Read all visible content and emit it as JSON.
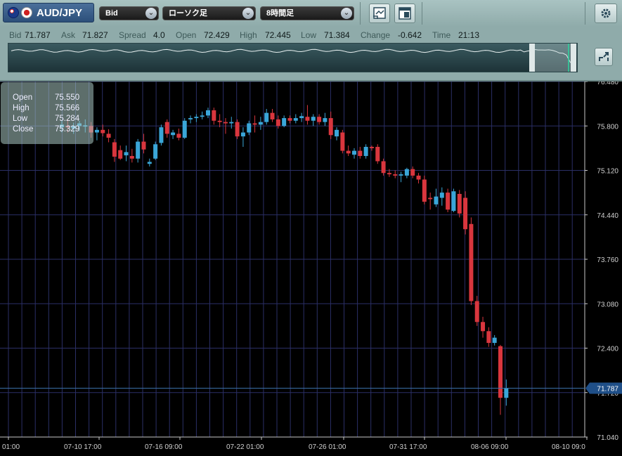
{
  "toolbar": {
    "symbol": "AUD/JPY",
    "price_type": "Bid",
    "chart_type": "ローソク足",
    "timeframe": "8時間足"
  },
  "quote": {
    "bid_label": "Bid",
    "bid": "71.787",
    "ask_label": "Ask",
    "ask": "71.827",
    "spread_label": "Spread",
    "spread": "4.0",
    "open_label": "Open",
    "open": "72.429",
    "high_label": "High",
    "high": "72.445",
    "low_label": "Low",
    "low": "71.384",
    "change_label": "Change",
    "change": "-0.642",
    "time_label": "Time",
    "time": "21:13"
  },
  "ohlc_popup": {
    "open_label": "Open",
    "open": "75.550",
    "high_label": "High",
    "high": "75.566",
    "low_label": "Low",
    "low": "75.284",
    "close_label": "Close",
    "close": "75.329"
  },
  "colors": {
    "up": "#3aa6d8",
    "down": "#d9363e",
    "grid": "#2b2f66",
    "axis_text": "#d0d0d0"
  },
  "chart_data": {
    "type": "candlestick",
    "ylim": [
      71.04,
      76.48
    ],
    "y_ticks": [
      "76.480",
      "75.800",
      "75.120",
      "74.440",
      "73.760",
      "73.080",
      "72.400",
      "71.720",
      "71.040"
    ],
    "x_ticks": [
      "01:00",
      "07-10 17:00",
      "07-16 09:00",
      "07-22 01:00",
      "07-26 01:00",
      "07-31 17:00",
      "08-06 09:00",
      "08-10 09:0"
    ],
    "current_price": "71.787",
    "candles": [
      {
        "o": 75.78,
        "h": 75.88,
        "l": 75.7,
        "c": 75.82
      },
      {
        "o": 75.8,
        "h": 75.9,
        "l": 75.7,
        "c": 75.78
      },
      {
        "o": 75.76,
        "h": 75.85,
        "l": 75.68,
        "c": 75.8
      },
      {
        "o": 75.8,
        "h": 75.88,
        "l": 75.72,
        "c": 75.84
      },
      {
        "o": 75.79,
        "h": 75.9,
        "l": 75.7,
        "c": 75.81
      },
      {
        "o": 75.8,
        "h": 75.86,
        "l": 75.62,
        "c": 75.7
      },
      {
        "o": 75.7,
        "h": 75.78,
        "l": 75.58,
        "c": 75.74
      },
      {
        "o": 75.74,
        "h": 75.82,
        "l": 75.64,
        "c": 75.69
      },
      {
        "o": 75.68,
        "h": 75.75,
        "l": 75.55,
        "c": 75.62
      },
      {
        "o": 75.55,
        "h": 75.6,
        "l": 75.25,
        "c": 75.33
      },
      {
        "o": 75.43,
        "h": 75.5,
        "l": 75.28,
        "c": 75.3
      },
      {
        "o": 75.35,
        "h": 75.5,
        "l": 75.26,
        "c": 75.4
      },
      {
        "o": 75.34,
        "h": 75.45,
        "l": 75.24,
        "c": 75.3
      },
      {
        "o": 75.3,
        "h": 75.6,
        "l": 75.24,
        "c": 75.56
      },
      {
        "o": 75.56,
        "h": 75.68,
        "l": 75.38,
        "c": 75.44
      },
      {
        "o": 75.22,
        "h": 75.3,
        "l": 75.18,
        "c": 75.25
      },
      {
        "o": 75.3,
        "h": 75.56,
        "l": 75.28,
        "c": 75.52
      },
      {
        "o": 75.54,
        "h": 75.82,
        "l": 75.5,
        "c": 75.78
      },
      {
        "o": 75.86,
        "h": 75.9,
        "l": 75.62,
        "c": 75.68
      },
      {
        "o": 75.66,
        "h": 75.74,
        "l": 75.6,
        "c": 75.7
      },
      {
        "o": 75.68,
        "h": 75.76,
        "l": 75.58,
        "c": 75.62
      },
      {
        "o": 75.62,
        "h": 75.92,
        "l": 75.6,
        "c": 75.88
      },
      {
        "o": 75.9,
        "h": 75.96,
        "l": 75.84,
        "c": 75.92
      },
      {
        "o": 75.92,
        "h": 75.98,
        "l": 75.86,
        "c": 75.94
      },
      {
        "o": 75.94,
        "h": 76.02,
        "l": 75.9,
        "c": 75.96
      },
      {
        "o": 75.96,
        "h": 76.08,
        "l": 75.92,
        "c": 76.04
      },
      {
        "o": 76.04,
        "h": 76.08,
        "l": 75.82,
        "c": 75.88
      },
      {
        "o": 75.88,
        "h": 75.98,
        "l": 75.78,
        "c": 75.86
      },
      {
        "o": 75.86,
        "h": 75.92,
        "l": 75.68,
        "c": 75.84
      },
      {
        "o": 75.84,
        "h": 75.94,
        "l": 75.76,
        "c": 75.86
      },
      {
        "o": 75.86,
        "h": 75.9,
        "l": 75.6,
        "c": 75.64
      },
      {
        "o": 75.64,
        "h": 75.78,
        "l": 75.48,
        "c": 75.7
      },
      {
        "o": 75.7,
        "h": 75.88,
        "l": 75.66,
        "c": 75.84
      },
      {
        "o": 75.84,
        "h": 75.96,
        "l": 75.7,
        "c": 75.82
      },
      {
        "o": 75.82,
        "h": 75.94,
        "l": 75.74,
        "c": 75.86
      },
      {
        "o": 75.86,
        "h": 76.06,
        "l": 75.82,
        "c": 76.0
      },
      {
        "o": 76.0,
        "h": 76.06,
        "l": 75.86,
        "c": 75.9
      },
      {
        "o": 75.9,
        "h": 75.96,
        "l": 75.76,
        "c": 75.8
      },
      {
        "o": 75.8,
        "h": 75.96,
        "l": 75.78,
        "c": 75.92
      },
      {
        "o": 75.92,
        "h": 75.96,
        "l": 75.84,
        "c": 75.88
      },
      {
        "o": 75.88,
        "h": 75.98,
        "l": 75.84,
        "c": 75.92
      },
      {
        "o": 75.92,
        "h": 76.0,
        "l": 75.86,
        "c": 75.95
      },
      {
        "o": 75.94,
        "h": 76.12,
        "l": 75.82,
        "c": 75.88
      },
      {
        "o": 75.88,
        "h": 75.98,
        "l": 75.8,
        "c": 75.94
      },
      {
        "o": 75.94,
        "h": 75.98,
        "l": 75.82,
        "c": 75.86
      },
      {
        "o": 75.86,
        "h": 76.0,
        "l": 75.8,
        "c": 75.92
      },
      {
        "o": 75.92,
        "h": 76.02,
        "l": 75.6,
        "c": 75.66
      },
      {
        "o": 75.64,
        "h": 75.78,
        "l": 75.58,
        "c": 75.74
      },
      {
        "o": 75.7,
        "h": 75.74,
        "l": 75.38,
        "c": 75.42
      },
      {
        "o": 75.42,
        "h": 75.5,
        "l": 75.34,
        "c": 75.38
      },
      {
        "o": 75.36,
        "h": 75.46,
        "l": 75.3,
        "c": 75.42
      },
      {
        "o": 75.42,
        "h": 75.48,
        "l": 75.3,
        "c": 75.34
      },
      {
        "o": 75.34,
        "h": 75.52,
        "l": 75.3,
        "c": 75.48
      },
      {
        "o": 75.48,
        "h": 75.5,
        "l": 75.42,
        "c": 75.46
      },
      {
        "o": 75.48,
        "h": 75.52,
        "l": 75.22,
        "c": 75.26
      },
      {
        "o": 75.26,
        "h": 75.3,
        "l": 75.04,
        "c": 75.08
      },
      {
        "o": 75.08,
        "h": 75.14,
        "l": 75.02,
        "c": 75.06
      },
      {
        "o": 75.06,
        "h": 75.12,
        "l": 75.0,
        "c": 75.04
      },
      {
        "o": 75.04,
        "h": 75.1,
        "l": 74.94,
        "c": 75.06
      },
      {
        "o": 75.04,
        "h": 75.16,
        "l": 75.0,
        "c": 75.14
      },
      {
        "o": 75.14,
        "h": 75.18,
        "l": 75.0,
        "c": 75.04
      },
      {
        "o": 75.04,
        "h": 75.08,
        "l": 74.92,
        "c": 74.98
      },
      {
        "o": 74.98,
        "h": 75.04,
        "l": 74.6,
        "c": 74.64
      },
      {
        "o": 74.7,
        "h": 74.78,
        "l": 74.52,
        "c": 74.68
      },
      {
        "o": 74.6,
        "h": 74.84,
        "l": 74.56,
        "c": 74.72
      },
      {
        "o": 74.7,
        "h": 74.86,
        "l": 74.58,
        "c": 74.78
      },
      {
        "o": 74.78,
        "h": 74.84,
        "l": 74.48,
        "c": 74.52
      },
      {
        "o": 74.5,
        "h": 74.84,
        "l": 74.48,
        "c": 74.8
      },
      {
        "o": 74.76,
        "h": 74.82,
        "l": 74.4,
        "c": 74.46
      },
      {
        "o": 74.7,
        "h": 74.8,
        "l": 74.14,
        "c": 74.22
      },
      {
        "o": 74.3,
        "h": 74.4,
        "l": 73.06,
        "c": 73.12
      },
      {
        "o": 73.12,
        "h": 73.2,
        "l": 72.74,
        "c": 72.8
      },
      {
        "o": 72.8,
        "h": 72.88,
        "l": 72.56,
        "c": 72.66
      },
      {
        "o": 72.66,
        "h": 72.72,
        "l": 72.42,
        "c": 72.48
      },
      {
        "o": 72.48,
        "h": 72.6,
        "l": 72.44,
        "c": 72.56
      },
      {
        "o": 72.43,
        "h": 72.45,
        "l": 71.38,
        "c": 71.64
      },
      {
        "o": 71.64,
        "h": 71.92,
        "l": 71.52,
        "c": 71.79
      }
    ]
  }
}
